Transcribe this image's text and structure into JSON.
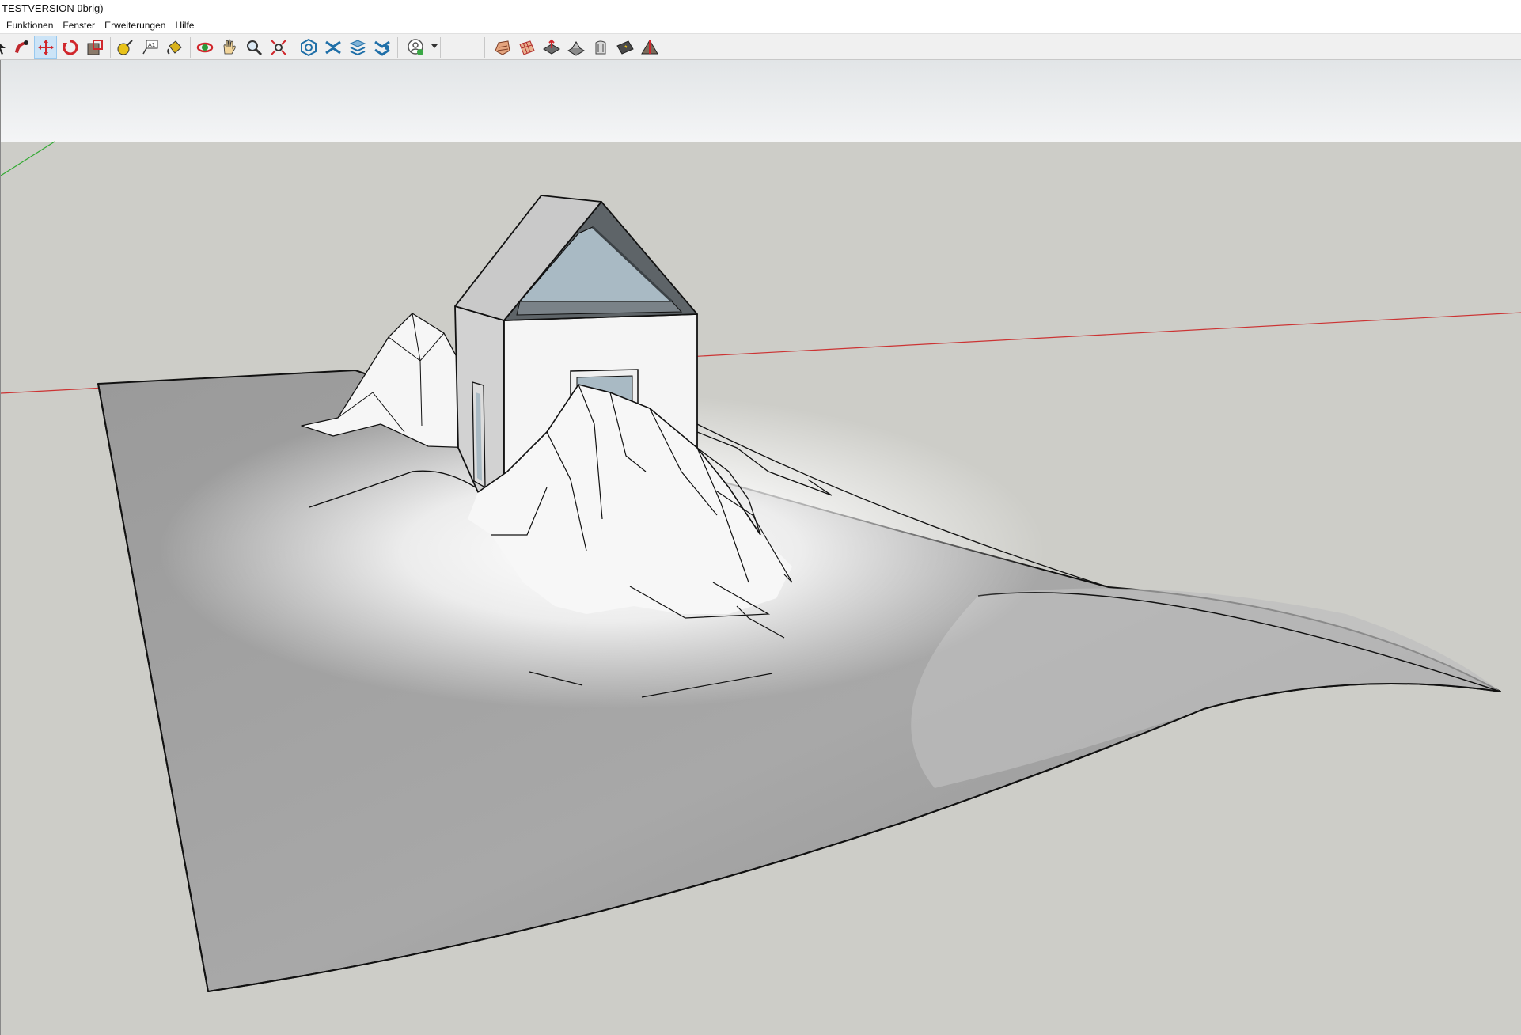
{
  "window": {
    "title": "TESTVERSION übrig)"
  },
  "menu": {
    "items": [
      "Funktionen",
      "Fenster",
      "Erweiterungen",
      "Hilfe"
    ]
  },
  "toolbar": {
    "groups": [
      {
        "name": "edit-tools",
        "tools": [
          {
            "icon": "select-arrow-icon",
            "active": false
          },
          {
            "icon": "follow-me-icon",
            "active": false
          },
          {
            "icon": "move-icon",
            "active": true
          },
          {
            "icon": "rotate-icon",
            "active": false
          },
          {
            "icon": "scale-icon",
            "active": false
          }
        ]
      },
      {
        "name": "construction-tools",
        "tools": [
          {
            "icon": "tape-measure-icon",
            "active": false
          },
          {
            "icon": "text-icon",
            "active": false
          },
          {
            "icon": "paint-bucket-icon",
            "active": false
          }
        ]
      },
      {
        "name": "camera-tools",
        "tools": [
          {
            "icon": "orbit-icon",
            "active": false
          },
          {
            "icon": "pan-icon",
            "active": false
          },
          {
            "icon": "zoom-icon",
            "active": false
          },
          {
            "icon": "zoom-extents-icon",
            "active": false
          }
        ]
      },
      {
        "name": "warehouse-tools",
        "tools": [
          {
            "icon": "3d-warehouse-icon",
            "active": false
          },
          {
            "icon": "extension-warehouse-icon",
            "active": false
          },
          {
            "icon": "layout-icon",
            "active": false
          },
          {
            "icon": "extension-manager-icon",
            "active": false
          }
        ]
      },
      {
        "name": "account",
        "tools": [
          {
            "icon": "user-account-icon",
            "active": false
          }
        ]
      },
      {
        "name": "sandbox-tools",
        "tools": [
          {
            "icon": "sandbox-from-contours-icon",
            "active": false
          },
          {
            "icon": "sandbox-from-scratch-icon",
            "active": false
          },
          {
            "icon": "smoove-icon",
            "active": false
          },
          {
            "icon": "stamp-icon",
            "active": false
          },
          {
            "icon": "drape-icon",
            "active": false
          },
          {
            "icon": "add-detail-icon",
            "active": false
          },
          {
            "icon": "flip-edge-icon",
            "active": false
          }
        ]
      }
    ]
  },
  "colors": {
    "background": "#cdcdc8",
    "sky": "#eef0f1",
    "terrain_light": "#ffffff",
    "terrain_dark": "#8c8c8c",
    "red_axis": "#cc3333",
    "green_axis": "#33aa33",
    "glass": "#a9bac4",
    "edge": "#111111",
    "active_tool": "#cce4f7"
  }
}
